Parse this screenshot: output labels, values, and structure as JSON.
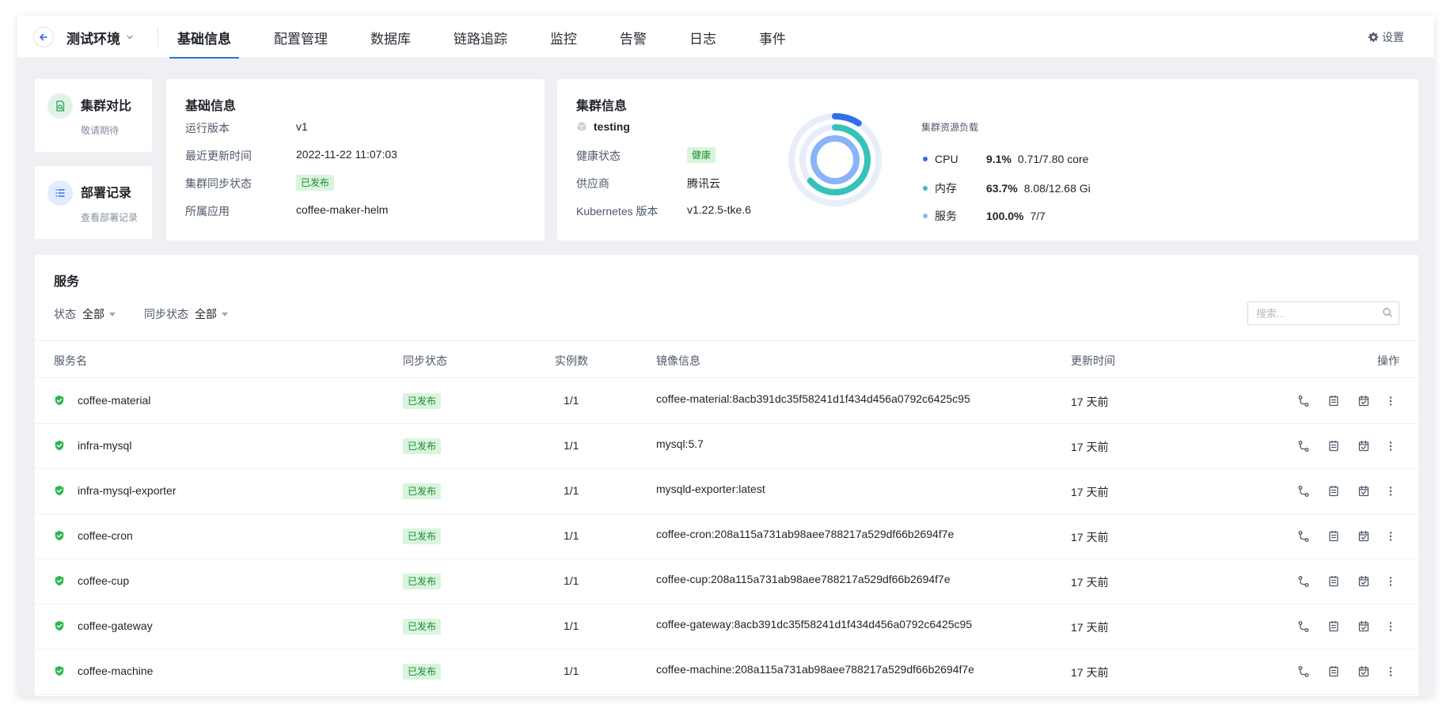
{
  "topbar": {
    "env_name": "测试环境",
    "tabs": [
      {
        "label": "基础信息",
        "active": true
      },
      {
        "label": "配置管理",
        "active": false
      },
      {
        "label": "数据库",
        "active": false
      },
      {
        "label": "链路追踪",
        "active": false
      },
      {
        "label": "监控",
        "active": false
      },
      {
        "label": "告警",
        "active": false
      },
      {
        "label": "日志",
        "active": false
      },
      {
        "label": "事件",
        "active": false
      }
    ],
    "settings_label": "设置"
  },
  "side_cards": {
    "compare": {
      "title": "集群对比",
      "subtitle": "敬请期待",
      "icon": "file-search-icon",
      "color": "#dff4e6"
    },
    "deploy": {
      "title": "部署记录",
      "subtitle": "查看部署记录",
      "icon": "list-icon",
      "color": "#e3ecfd"
    }
  },
  "basic_info": {
    "title": "基础信息",
    "rows": [
      {
        "key": "运行版本",
        "value": "v1"
      },
      {
        "key": "最近更新时间",
        "value": "2022-11-22 11:07:03"
      },
      {
        "key": "集群同步状态",
        "value": "已发布"
      },
      {
        "key": "所属应用",
        "value": "coffee-maker-helm"
      }
    ]
  },
  "cluster_info": {
    "title": "集群信息",
    "cluster_name": "testing",
    "rows": [
      {
        "key": "健康状态",
        "value": "健康"
      },
      {
        "key": "供应商",
        "value": "腾讯云"
      },
      {
        "key": "Kubernetes 版本",
        "value": "v1.22.5-tke.6"
      }
    ],
    "resource_title": "集群资源负载",
    "resources": [
      {
        "name": "CPU",
        "percent": "9.1%",
        "detail": "0.71/7.80 core",
        "fraction": 0.091,
        "color": "#2f6fe8"
      },
      {
        "name": "内存",
        "percent": "63.7%",
        "detail": "8.08/12.68 Gi",
        "fraction": 0.637,
        "color": "#36c2b9"
      },
      {
        "name": "服务",
        "percent": "100.0%",
        "detail": "7/7",
        "fraction": 1.0,
        "color": "#8ab4f8"
      }
    ]
  },
  "services": {
    "title": "服务",
    "filters": [
      {
        "key": "状态",
        "value": "全部"
      },
      {
        "key": "同步状态",
        "value": "全部"
      }
    ],
    "search_placeholder": "搜索...",
    "columns": {
      "name": "服务名",
      "sync_status": "同步状态",
      "instances": "实例数",
      "image": "镜像信息",
      "updated": "更新时间",
      "actions": "操作"
    },
    "rows": [
      {
        "name": "coffee-material",
        "sync_status": "已发布",
        "instances": "1/1",
        "image": "coffee-material:8acb391dc35f58241d1f434d456a0792c6425c95",
        "updated": "17 天前"
      },
      {
        "name": "infra-mysql",
        "sync_status": "已发布",
        "instances": "1/1",
        "image": "mysql:5.7",
        "updated": "17 天前"
      },
      {
        "name": "infra-mysql-exporter",
        "sync_status": "已发布",
        "instances": "1/1",
        "image": "mysqld-exporter:latest",
        "updated": "17 天前"
      },
      {
        "name": "coffee-cron",
        "sync_status": "已发布",
        "instances": "1/1",
        "image": "coffee-cron:208a115a731ab98aee788217a529df66b2694f7e",
        "updated": "17 天前"
      },
      {
        "name": "coffee-cup",
        "sync_status": "已发布",
        "instances": "1/1",
        "image": "coffee-cup:208a115a731ab98aee788217a529df66b2694f7e",
        "updated": "17 天前"
      },
      {
        "name": "coffee-gateway",
        "sync_status": "已发布",
        "instances": "1/1",
        "image": "coffee-gateway:8acb391dc35f58241d1f434d456a0792c6425c95",
        "updated": "17 天前"
      },
      {
        "name": "coffee-machine",
        "sync_status": "已发布",
        "instances": "1/1",
        "image": "coffee-machine:208a115a731ab98aee788217a529df66b2694f7e",
        "updated": "17 天前"
      }
    ]
  }
}
